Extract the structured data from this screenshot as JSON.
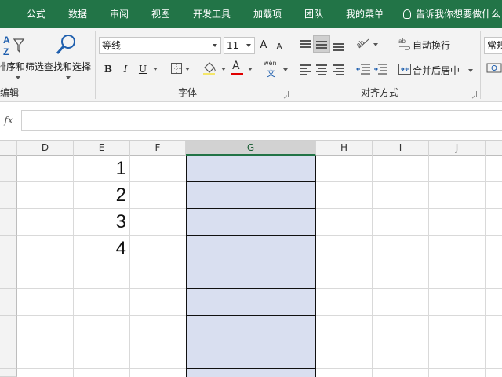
{
  "menu": {
    "items": [
      "公式",
      "数据",
      "审阅",
      "视图",
      "开发工具",
      "加载项",
      "团队",
      "我的菜单"
    ],
    "tell_me": "告诉我你想要做什么"
  },
  "ribbon": {
    "editing": {
      "sort_filter_label": "排序和筛选",
      "find_select_label": "查找和选择",
      "group_label": "编辑"
    },
    "font": {
      "font_name": "等线",
      "font_size": "11",
      "bold": "B",
      "italic": "I",
      "underline": "U",
      "grow": "A",
      "shrink": "A",
      "font_color_glyph": "A",
      "phonetic_top": "wén",
      "phonetic_bottom": "文",
      "group_label": "字体"
    },
    "alignment": {
      "wrap_text": "自动换行",
      "merge_center": "合并后居中",
      "group_label": "对齐方式"
    },
    "number": {
      "format": "常规"
    }
  },
  "formula_bar": {
    "fx_label": "fx",
    "value": ""
  },
  "sheet": {
    "columns": [
      "D",
      "E",
      "F",
      "G",
      "H",
      "I",
      "J"
    ],
    "selected_column": "G",
    "values_E": [
      "1",
      "2",
      "3",
      "4"
    ]
  },
  "colors": {
    "accent": "#227447",
    "selection_fill": "#d9dff0",
    "font_color_bar": "#e00000"
  }
}
